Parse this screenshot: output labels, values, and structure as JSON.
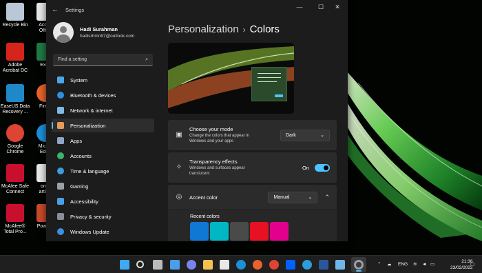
{
  "desktop_icons": [
    {
      "label": "Recycle Bin",
      "icon": "recycle-bin-icon",
      "color": "#b9c7d6"
    },
    {
      "label": "Accou\nOffice",
      "icon": "file-icon",
      "color": "#e8e8e8"
    },
    {
      "label": "Adobe\nAcrobat DC",
      "icon": "acrobat-icon",
      "color": "#d4241b"
    },
    {
      "label": "Exce",
      "icon": "excel-icon",
      "color": "#1f7a45"
    },
    {
      "label": "EaseUS Data\nRecovery ...",
      "icon": "easeus-icon",
      "color": "#1e88c9"
    },
    {
      "label": "Firefo",
      "icon": "firefox-icon",
      "color": "#e8632b"
    },
    {
      "label": "Google\nChrome",
      "icon": "chrome-icon",
      "color": "#dd4433"
    },
    {
      "label": "Micros\nEdge",
      "icon": "edge-icon",
      "color": "#1c8fd6"
    },
    {
      "label": "McAfee Safe\nConnect",
      "icon": "mcafee-icon",
      "color": "#c8102e"
    },
    {
      "label": "orde\nartikel",
      "icon": "file-icon",
      "color": "#e8e8e8"
    },
    {
      "label": "McAfee®\nTotal Pro...",
      "icon": "mcafee-icon",
      "color": "#c8102e"
    },
    {
      "label": "PowerP",
      "icon": "powerpoint-icon",
      "color": "#c94a2a"
    }
  ],
  "window": {
    "title": "Settings",
    "back_glyph": "←",
    "minimize_glyph": "—",
    "maximize_glyph": "☐",
    "close_glyph": "✕"
  },
  "profile": {
    "name": "Hadi Surahman",
    "email": "hadisrhmn97@outlook.com"
  },
  "search": {
    "placeholder": "Find a setting",
    "icon_glyph": "⌕"
  },
  "nav": {
    "items": [
      {
        "label": "System",
        "icon": "system-icon",
        "color": "#4aa8e8"
      },
      {
        "label": "Bluetooth & devices",
        "icon": "bluetooth-icon",
        "color": "#2f8fe0"
      },
      {
        "label": "Network & internet",
        "icon": "network-icon",
        "color": "#7fb9e6"
      },
      {
        "label": "Personalization",
        "icon": "brush-icon",
        "color": "#e59b5b"
      },
      {
        "label": "Apps",
        "icon": "apps-icon",
        "color": "#8fa6c8"
      },
      {
        "label": "Accounts",
        "icon": "accounts-icon",
        "color": "#3db26a"
      },
      {
        "label": "Time & language",
        "icon": "time-language-icon",
        "color": "#3d9be0"
      },
      {
        "label": "Gaming",
        "icon": "gaming-icon",
        "color": "#9aa0a6"
      },
      {
        "label": "Accessibility",
        "icon": "accessibility-icon",
        "color": "#4a9fe8"
      },
      {
        "label": "Privacy & security",
        "icon": "shield-icon",
        "color": "#8a8f95"
      },
      {
        "label": "Windows Update",
        "icon": "update-icon",
        "color": "#3d8fe0"
      }
    ],
    "active_index": 3
  },
  "breadcrumb": {
    "parent": "Personalization",
    "separator": "›",
    "current": "Colors"
  },
  "mode": {
    "title": "Choose your mode",
    "description": "Change the colors that appear in\nWindows and your apps",
    "value": "Dark",
    "icon": "mode-icon"
  },
  "transparency": {
    "title": "Transparency effects",
    "description": "Windows and surfaces appear\ntranslucent",
    "state_label": "On"
  },
  "accent": {
    "title": "Accent color",
    "value": "Manual",
    "recent_label": "Recent colors",
    "recent_colors": [
      "#0f78d4",
      "#00b7c3",
      "#4a4a4a",
      "#e81123",
      "#e3008c"
    ]
  },
  "colors": {
    "accent": "#4cc2ff",
    "window_bg": "#1c1c1c",
    "card_bg": "#2b2b2b"
  },
  "taskbar": {
    "icons": [
      {
        "icon": "windows-start-icon",
        "color": "#3fa9f5"
      },
      {
        "icon": "search-icon",
        "color": "#dddddd"
      },
      {
        "icon": "task-view-icon",
        "color": "#bbbbbb"
      },
      {
        "icon": "widgets-icon",
        "color": "#4a9fe8"
      },
      {
        "icon": "chat-icon",
        "color": "#7b83eb"
      },
      {
        "icon": "file-explorer-icon",
        "color": "#f2c14e"
      },
      {
        "icon": "store-icon",
        "color": "#e8e8e8"
      },
      {
        "icon": "edge-icon",
        "color": "#1c8fd6"
      },
      {
        "icon": "firefox-icon",
        "color": "#e8632b"
      },
      {
        "icon": "chrome-icon",
        "color": "#dd4433"
      },
      {
        "icon": "dropbox-icon",
        "color": "#0061fe"
      },
      {
        "icon": "photos-icon",
        "color": "#2d9cdb"
      },
      {
        "icon": "word-icon",
        "color": "#2b579a"
      },
      {
        "icon": "notepad-icon",
        "color": "#6fb7e8"
      },
      {
        "icon": "settings-icon",
        "color": "#9aa0a6"
      }
    ],
    "language": "ENG",
    "time": "21:36",
    "date": "23/02/2022"
  }
}
